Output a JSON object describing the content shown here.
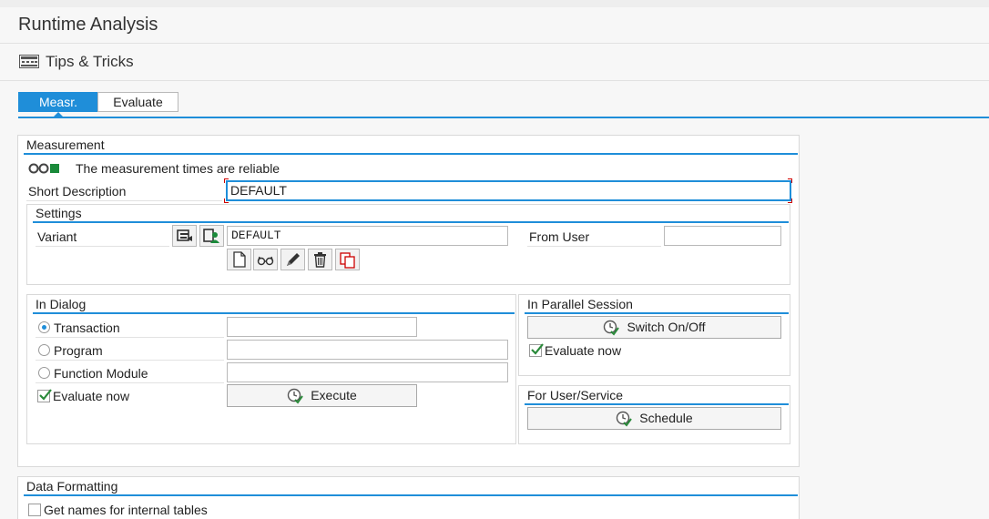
{
  "title": "Runtime Analysis",
  "toolbar": {
    "tips_label": "Tips & Tricks",
    "tips_icon": "tips-icon"
  },
  "tabs": {
    "measr": "Measr.",
    "evaluate": "Evaluate",
    "active": "Measr."
  },
  "measurement": {
    "title": "Measurement",
    "status_text": "The measurement times are reliable",
    "status_icon": "traffic-light-green-icon",
    "short_description_label": "Short Description",
    "short_description_value": "DEFAULT",
    "settings": {
      "title": "Settings",
      "variant_label": "Variant",
      "variant_value": "DEFAULT",
      "from_user_label": "From User",
      "from_user_value": ""
    },
    "in_dialog": {
      "title": "In Dialog",
      "transaction_label": "Transaction",
      "program_label": "Program",
      "function_module_label": "Function Module",
      "evaluate_now_label": "Evaluate now",
      "selected": "Transaction",
      "evaluate_now_checked": true,
      "execute_label": "Execute"
    },
    "parallel_session": {
      "title": "In Parallel Session",
      "switch_label": "Switch On/Off",
      "evaluate_now_label": "Evaluate now",
      "evaluate_now_checked": true
    },
    "user_service": {
      "title": "For User/Service",
      "schedule_label": "Schedule"
    }
  },
  "data_formatting": {
    "title": "Data Formatting",
    "internal_tables_label": "Get names for internal tables",
    "internal_tables_checked": false
  },
  "colors": {
    "accent": "#1f8ed9",
    "status_green": "#1a8a3a",
    "check_green": "#2a8a3a"
  }
}
